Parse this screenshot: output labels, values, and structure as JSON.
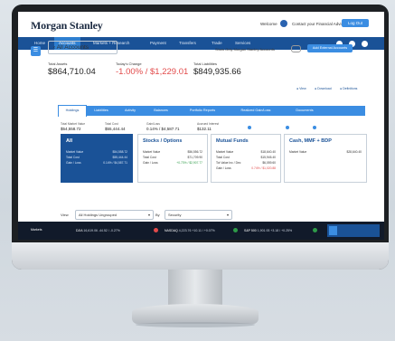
{
  "header": {
    "brand": "Morgan Stanley",
    "welcome": "Welcome",
    "contact": "Contact your Financial Advisor",
    "logout": "Log Out"
  },
  "nav": {
    "items": [
      "Home",
      "Accounts",
      "Markets + Research",
      "Payment",
      "Transfers",
      "Trade",
      "Services"
    ],
    "active": "Accounts"
  },
  "accounts": {
    "selector": "All Accounts",
    "show_only": "Show Only Morgan Stanley Accounts",
    "add_external": "Add External Accounts",
    "total_assets_label": "Total Assets",
    "total_assets": "$864,710.04",
    "change_label": "Today's Change",
    "change": "-1.00% / $1,229.01",
    "liabilities_label": "Total Liabilities",
    "liabilities": "$849,935.66",
    "view_label": "View",
    "download_label": "Download",
    "definitions_label": "Definitions"
  },
  "tabs": [
    "Holdings",
    "Liabilities",
    "Activity",
    "Balances",
    "Portfolio Reports",
    "Realized Gain/Loss",
    "Documents"
  ],
  "stats": [
    {
      "label": "Total Market Value",
      "value": "$54,558.72"
    },
    {
      "label": "Total Cost",
      "value": "$55,444.44"
    },
    {
      "label": "Gain/Loss",
      "value": "0.14% / $4,587.71"
    },
    {
      "label": "Accrued Interest",
      "value": "$132.11"
    }
  ],
  "cards": [
    {
      "title": "All",
      "rows": [
        {
          "k": "Market Value",
          "v": "$54,558.72"
        },
        {
          "k": "Total Cost",
          "v": "$55,444.44"
        },
        {
          "k": "Gain / Loss",
          "v": "0.14% / $4,587.71"
        }
      ]
    },
    {
      "title": "Stocks / Options",
      "rows": [
        {
          "k": "Market Value",
          "v": "$56,556.72"
        },
        {
          "k": "Total Cost",
          "v": "$71,709.90"
        },
        {
          "k": "Gain / Loss",
          "v": "+0.73% / $2,907.77"
        }
      ]
    },
    {
      "title": "Mutual Funds",
      "rows": [
        {
          "k": "Market Value",
          "v": "$18,640.40"
        },
        {
          "k": "Total Cost",
          "v": "$15,945.40"
        },
        {
          "k": "Tot Value Inc / Dec",
          "v": "$6,059.60"
        },
        {
          "k": "Gain / Loss",
          "v": "0.74% / $1,020.88"
        }
      ]
    },
    {
      "title": "Cash, MMF + BDP",
      "rows": [
        {
          "k": "Market Value",
          "v": "$28,640.40"
        }
      ]
    }
  ],
  "filters": {
    "view_label": "View",
    "view_value": "All Holdings Ungrouped",
    "by_label": "By",
    "by_value": "Security"
  },
  "ticker": {
    "label": "Markets",
    "items": [
      {
        "name": "DJIA",
        "value": "16,619.06  -44.52 / -0.27%"
      },
      {
        "name": "NASDAQ",
        "value": "4,223.76  +10.11 / +0.07%"
      },
      {
        "name": "S&P 500",
        "value": "1,901.93  +3.18 / +0.25%"
      }
    ]
  },
  "colors": {
    "brand_blue": "#1a5297",
    "accent": "#3b8de2",
    "negative": "#e24a4a",
    "positive": "#2e9b48"
  }
}
